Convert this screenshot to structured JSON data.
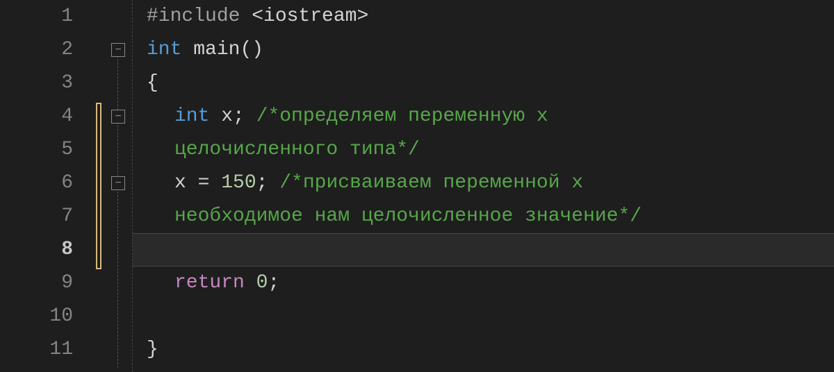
{
  "lineNumbers": [
    "1",
    "2",
    "3",
    "4",
    "5",
    "6",
    "7",
    "8",
    "9",
    "10",
    "11"
  ],
  "currentLine": 8,
  "fold": {
    "collapseSymbol": "−"
  },
  "code": {
    "l1": {
      "include": "#include",
      "header": " <iostream>"
    },
    "l2": {
      "kw_int": "int",
      "func": " main",
      "paren": "()"
    },
    "l3": {
      "brace": "{"
    },
    "l4": {
      "kw_int": "int",
      "var": " x",
      "semi": ";",
      "comment": " /*определяем переменную x"
    },
    "l5": {
      "comment": "целочисленного типа*/"
    },
    "l6": {
      "var": "x ",
      "eq": "= ",
      "num": "150",
      "semi": ";",
      "comment": " /*присваиваем переменной x"
    },
    "l7": {
      "comment": "необходимое нам целочисленное значение*/"
    },
    "l8": {
      "blank": ""
    },
    "l9": {
      "ret": "return",
      "sp": " ",
      "zero": "0",
      "semi": ";"
    },
    "l10": {
      "blank": ""
    },
    "l11": {
      "brace": "}"
    }
  }
}
